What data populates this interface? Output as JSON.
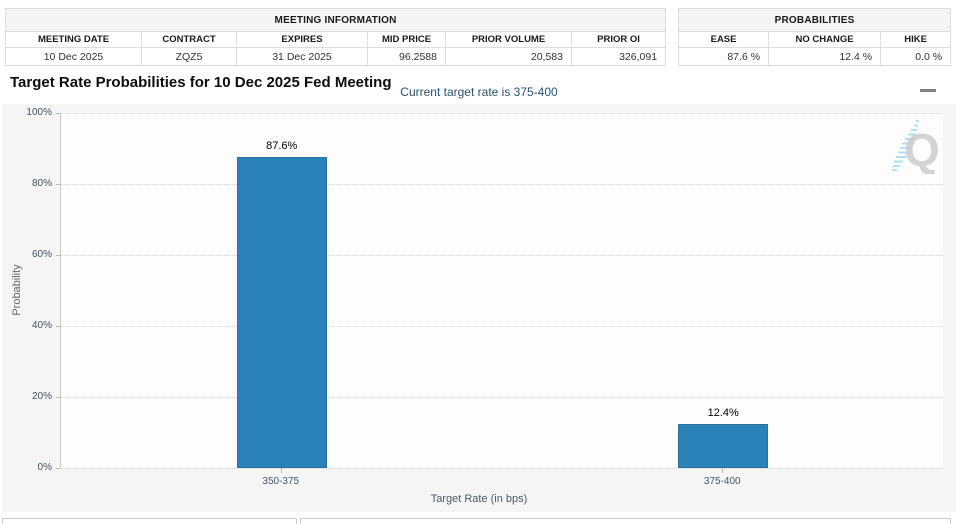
{
  "meeting_information": {
    "title": "MEETING INFORMATION",
    "columns": [
      "MEETING DATE",
      "CONTRACT",
      "EXPIRES",
      "MID PRICE",
      "PRIOR VOLUME",
      "PRIOR OI"
    ],
    "row": [
      "10 Dec 2025",
      "ZQZ5",
      "31 Dec 2025",
      "96.2588",
      "20,583",
      "326,091"
    ]
  },
  "probabilities": {
    "title": "PROBABILITIES",
    "columns": [
      "EASE",
      "NO CHANGE",
      "HIKE"
    ],
    "row": [
      "87.6 %",
      "12.4 %",
      "0.0 %"
    ]
  },
  "icons": {
    "menu": "hamburger-menu",
    "watermark": "quikstrike-q-logo"
  },
  "colors": {
    "bar": "#2b82b9",
    "subtitle_navy": "#2a5277",
    "panel_gray": "#f5f5f6"
  },
  "chart_data": {
    "type": "bar",
    "title": "Target Rate Probabilities for 10 Dec 2025 Fed Meeting",
    "subtitle": "Current target rate is 375-400",
    "categories": [
      "350-375",
      "375-400"
    ],
    "values": [
      87.6,
      12.4
    ],
    "bar_labels": [
      "87.6%",
      "12.4%"
    ],
    "xlabel": "Target Rate (in bps)",
    "ylabel": "Probability",
    "ylim": [
      0,
      100
    ],
    "ytick_step": 20,
    "ytick_labels": [
      "0%",
      "20%",
      "40%",
      "60%",
      "80%",
      "100%"
    ],
    "grid": "dotted",
    "legend": "none",
    "bar_color": "#2b82b9",
    "bar_centers": [
      0.25,
      0.75
    ]
  }
}
